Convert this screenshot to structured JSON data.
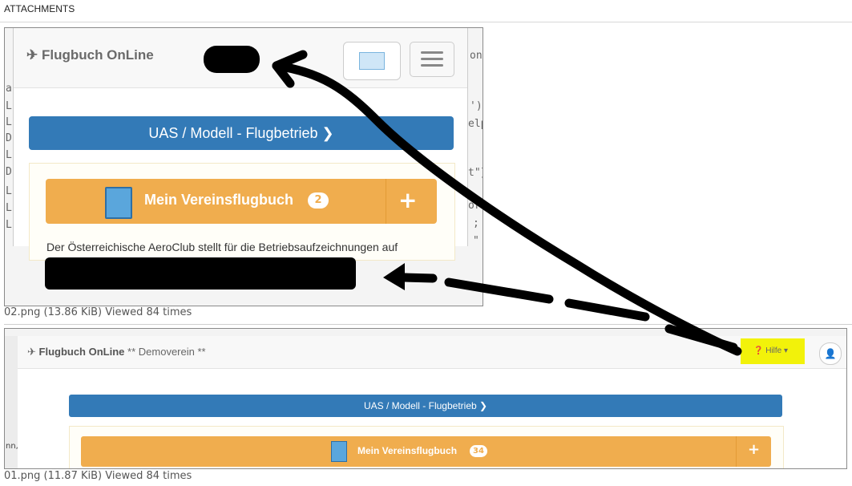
{
  "header": {
    "title": "ATTACHMENTS"
  },
  "attachments": [
    {
      "caption": "02.png (13.86 KiB) Viewed 84 times",
      "screen": {
        "brand": "✈ Flugbuch OnLine",
        "mode_button": "UAS / Modell - Flugbetrieb ❯",
        "logbook_button": "Mein Vereinsflugbuch",
        "logbook_count": "2",
        "add_symbol": "+",
        "description": "Der Österreichische AeroClub stellt für die Betriebsaufzeichnungen auf",
        "code_right": [
          "on",
          "')",
          "elp",
          "t\"}",
          "or",
          ";",
          "\""
        ],
        "code_left": [
          "a",
          "L",
          "L",
          "D",
          "L",
          "D",
          "L",
          "L",
          "L"
        ]
      }
    },
    {
      "caption": "01.png (11.87 KiB) Viewed 84 times",
      "screen": {
        "brand": "Flugbuch OnLine",
        "brand_suffix": "** Demoverein **",
        "help_menu": "❓ Hilfe ▾",
        "user_icon": "👤",
        "mode_button": "UAS / Modell - Flugbetrieb ❯",
        "logbook_button": "Mein Vereinsflugbuch",
        "logbook_count": "34",
        "add_symbol": "+",
        "left_clip": "nn,"
      }
    }
  ],
  "colors": {
    "primary": "#337ab7",
    "warning": "#f0ad4e",
    "highlight": "#f2f20a",
    "annotation": "#000000"
  }
}
